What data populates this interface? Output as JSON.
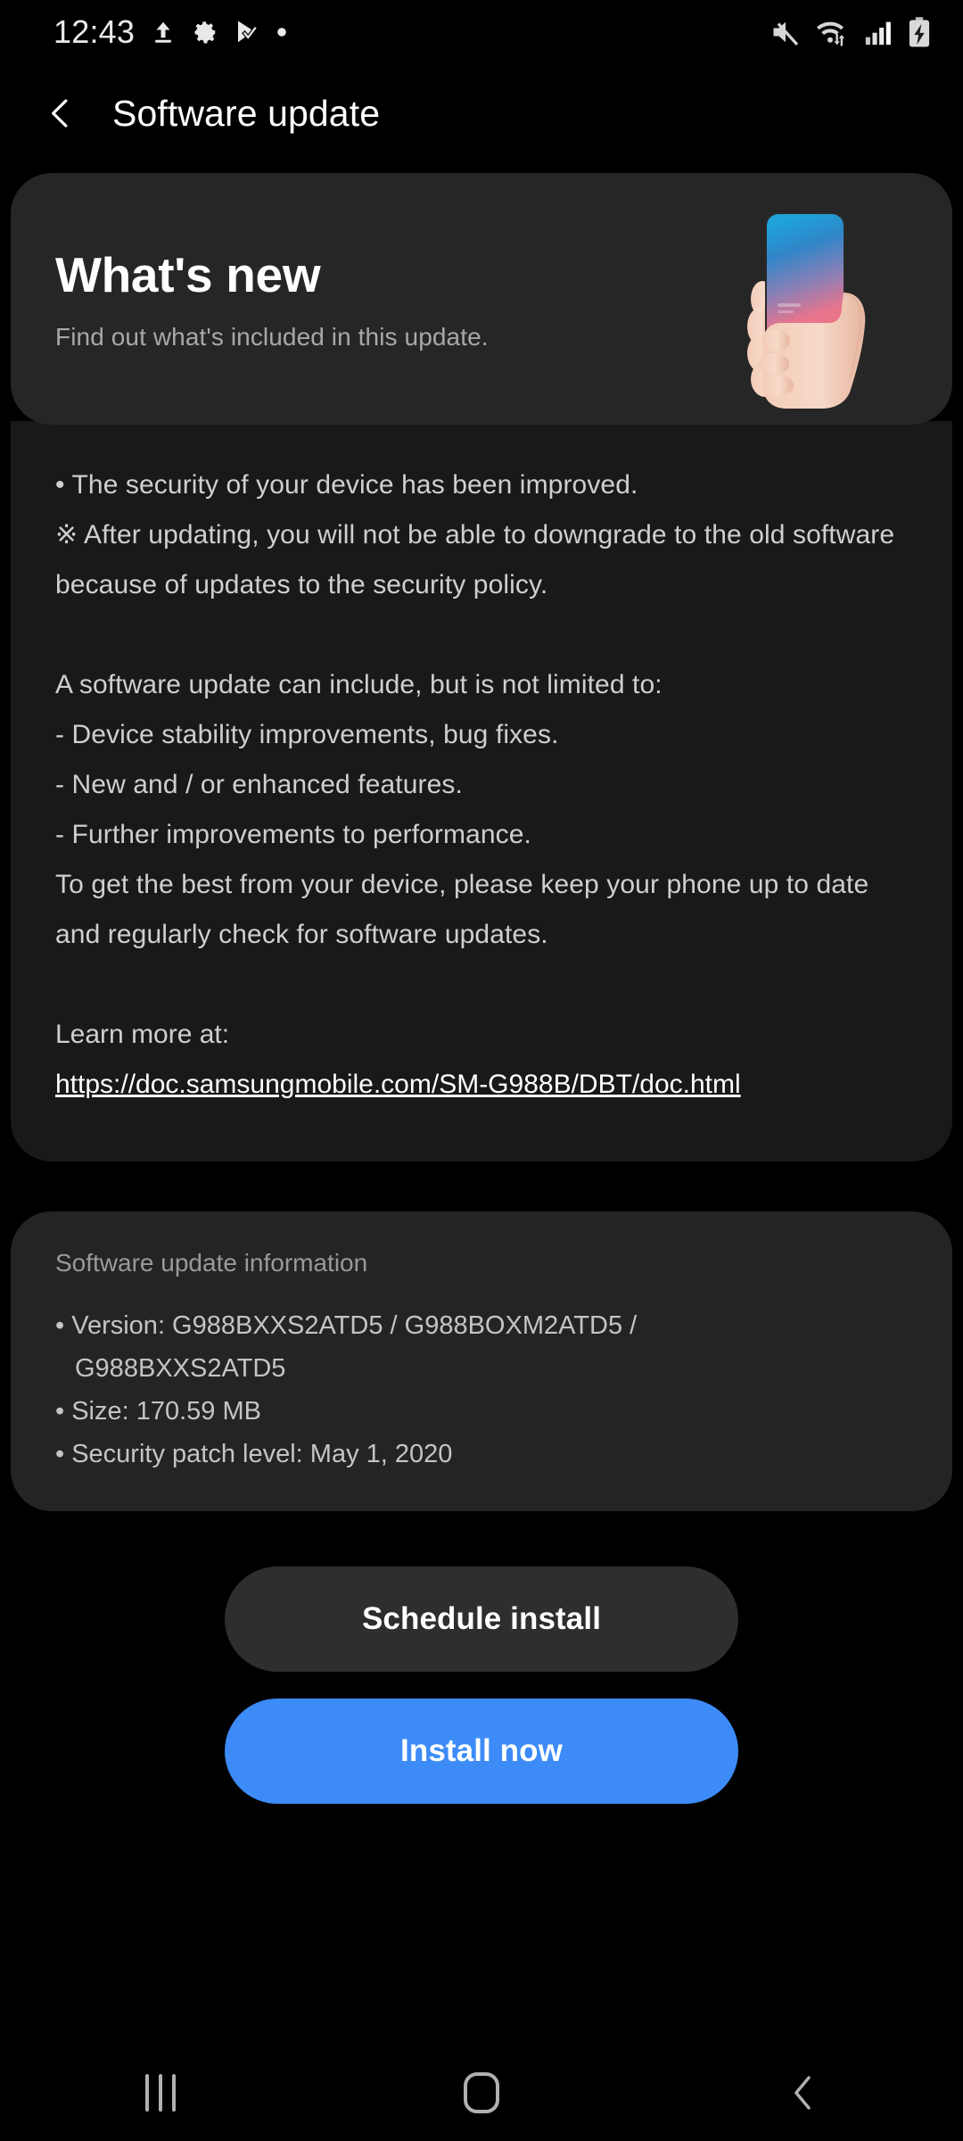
{
  "status_bar": {
    "clock": "12:43",
    "left_icons": [
      "upload-icon",
      "gear-icon",
      "play-store-check-icon",
      "dot-icon"
    ],
    "right_icons": [
      "mute-icon",
      "wifi-transfer-icon",
      "signal-bars-icon",
      "battery-charging-icon"
    ]
  },
  "app_bar": {
    "back_icon": "chevron-left-icon",
    "title": "Software update"
  },
  "banner": {
    "title": "What's new",
    "subtitle": "Find out what's included in this update.",
    "illustration": "hand-holding-phone-illustration"
  },
  "release_notes": {
    "lines": [
      "• The security of your device has been improved.",
      "※ After updating, you will not be able to downgrade to the old software because of updates to the security policy."
    ],
    "paragraph2": [
      "A software update can include, but is not limited to:",
      " - Device stability improvements, bug fixes.",
      " - New and / or enhanced features.",
      " - Further improvements to performance.",
      "To get the best from your device, please keep your phone up to date and regularly check for software updates."
    ],
    "learn_more_label": "Learn more at:",
    "learn_more_url": "https://doc.samsungmobile.com/SM-G988B/DBT/doc.html"
  },
  "info_card": {
    "title": "Software update information",
    "version_line": "• Version: G988BXXS2ATD5 / G988BOXM2ATD5 /",
    "version_cont": "G988BXXS2ATD5",
    "size_line": "• Size: 170.59 MB",
    "patch_line": "• Security patch level: May 1, 2020"
  },
  "actions": {
    "schedule_label": "Schedule install",
    "install_label": "Install now",
    "primary_color": "#3d8bf7"
  },
  "nav_bar": {
    "recents_icon": "recents-icon",
    "home_icon": "home-icon",
    "back_icon": "back-icon"
  }
}
